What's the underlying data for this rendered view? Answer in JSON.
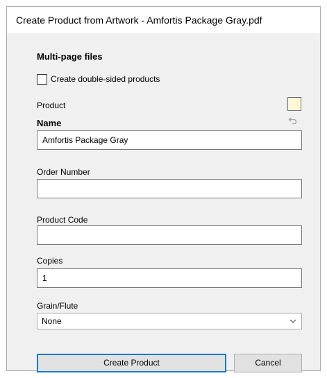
{
  "window": {
    "title": "Create Product from Artwork - Amfortis Package Gray.pdf"
  },
  "multipage": {
    "section_title": "Multi-page files",
    "double_sided_label": "Create double-sided products",
    "double_sided_checked": false
  },
  "product": {
    "label": "Product",
    "swatch_color": "#fdf8d6"
  },
  "fields": {
    "name_label": "Name",
    "name_value": "Amfortis Package Gray",
    "order_number_label": "Order Number",
    "order_number_value": "",
    "product_code_label": "Product Code",
    "product_code_value": "",
    "copies_label": "Copies",
    "copies_value": "1",
    "grain_label": "Grain/Flute",
    "grain_selected": "None"
  },
  "buttons": {
    "create_label": "Create Product",
    "cancel_label": "Cancel"
  },
  "colors": {
    "accent": "#0078d7",
    "dialog_bg": "#f0f0f0"
  }
}
